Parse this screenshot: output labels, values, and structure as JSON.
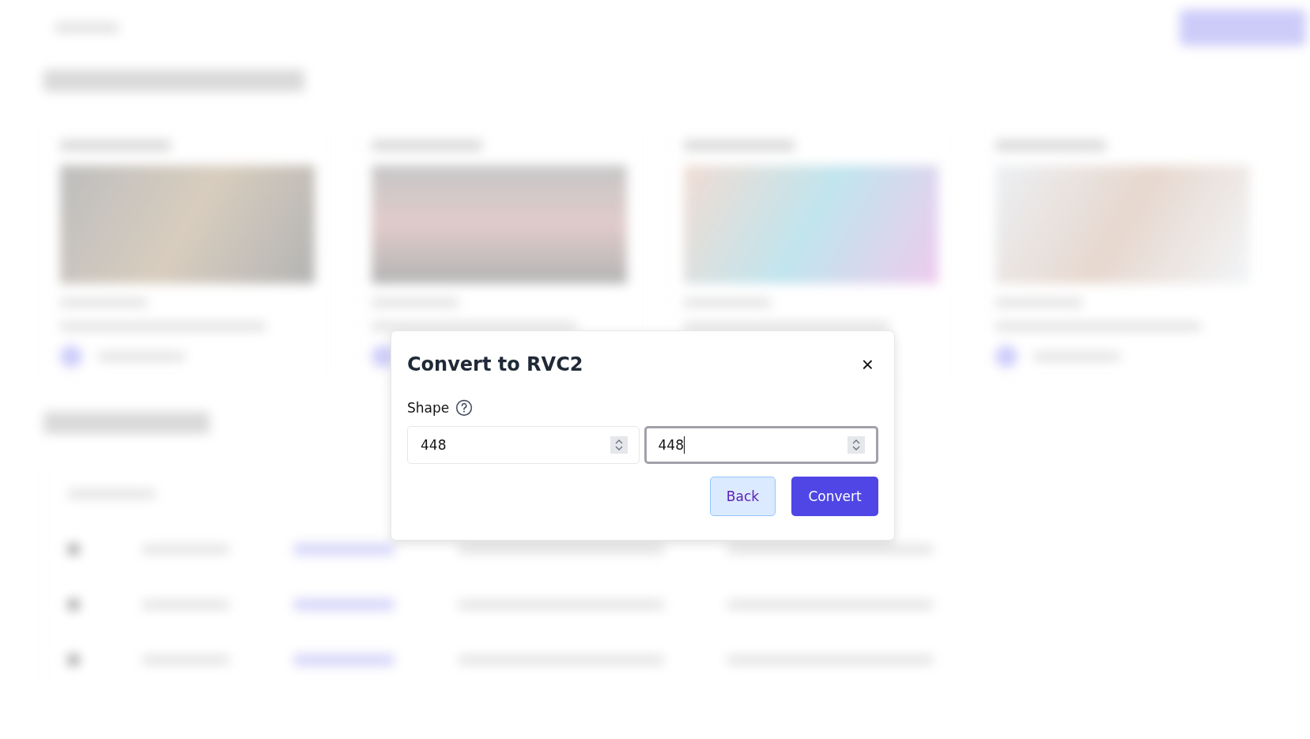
{
  "dialog": {
    "title": "Convert to RVC2",
    "close_icon": "×",
    "field_label": "Shape",
    "fields": [
      {
        "value": "448",
        "focused": false
      },
      {
        "value": "448",
        "focused": true
      }
    ],
    "buttons": [
      {
        "label": "Back",
        "kind": "secondary"
      },
      {
        "label": "Convert",
        "kind": "primary"
      }
    ]
  }
}
